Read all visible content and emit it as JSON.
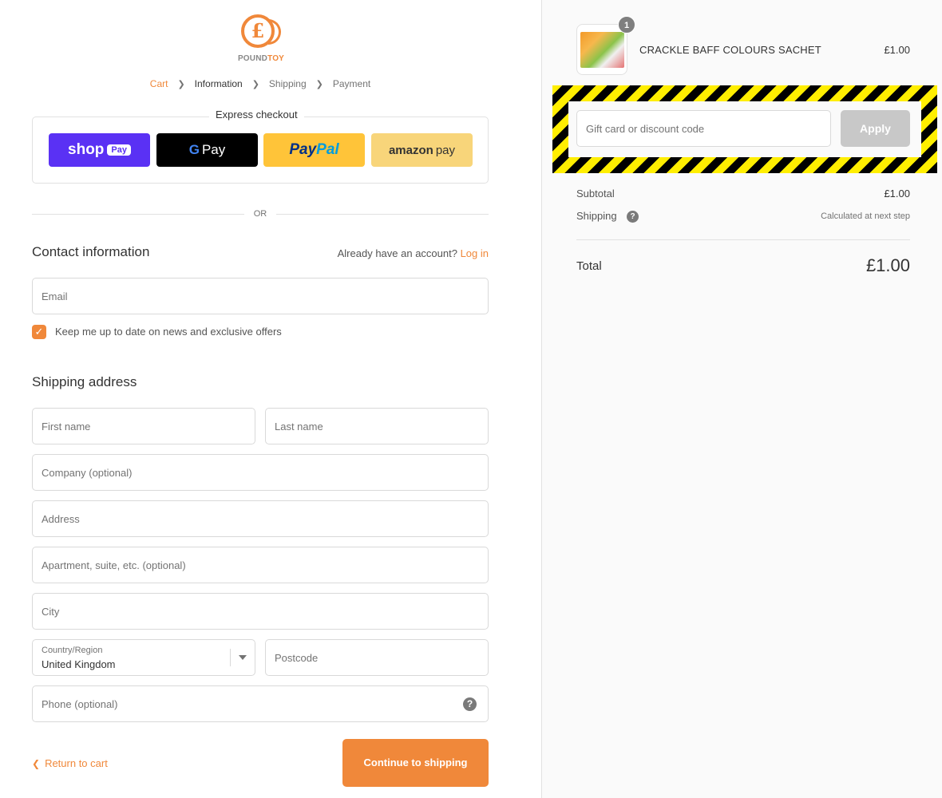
{
  "brand": {
    "logo_symbol": "£",
    "name_part1": "POUND",
    "name_part2": "TOY"
  },
  "breadcrumb": [
    "Cart",
    "Information",
    "Shipping",
    "Payment"
  ],
  "express": {
    "title": "Express checkout",
    "shop_word": "shop",
    "shop_pill": "Pay",
    "gpay_g": "G",
    "gpay_text": "Pay",
    "paypal_1": "Pay",
    "paypal_2": "Pal",
    "amazon_1": "amazon",
    "amazon_2": "pay"
  },
  "or_text": "OR",
  "contact": {
    "title": "Contact information",
    "account_prompt": "Already have an account?",
    "login_label": "Log in",
    "email_placeholder": "Email",
    "newsletter_label": "Keep me up to date on news and exclusive offers",
    "newsletter_checked": true
  },
  "shipping": {
    "title": "Shipping address",
    "first_name": "First name",
    "last_name": "Last name",
    "company": "Company (optional)",
    "address": "Address",
    "apartment": "Apartment, suite, etc. (optional)",
    "city": "City",
    "country_label": "Country/Region",
    "country_value": "United Kingdom",
    "postcode": "Postcode",
    "phone": "Phone (optional)"
  },
  "actions": {
    "return_label": "Return to cart",
    "continue_label": "Continue to shipping"
  },
  "summary": {
    "quantity": "1",
    "product_name": "CRACKLE BAFF COLOURS SACHET",
    "product_price": "£1.00",
    "discount_placeholder": "Gift card or discount code",
    "apply_label": "Apply",
    "subtotal_label": "Subtotal",
    "subtotal_value": "£1.00",
    "shipping_label": "Shipping",
    "shipping_value": "Calculated at next step",
    "total_label": "Total",
    "total_value": "£1.00"
  },
  "colors": {
    "accent": "#f0883a",
    "shop_pay": "#5a31f4",
    "paypal": "#ffc439",
    "amazon": "#f8d57a"
  }
}
